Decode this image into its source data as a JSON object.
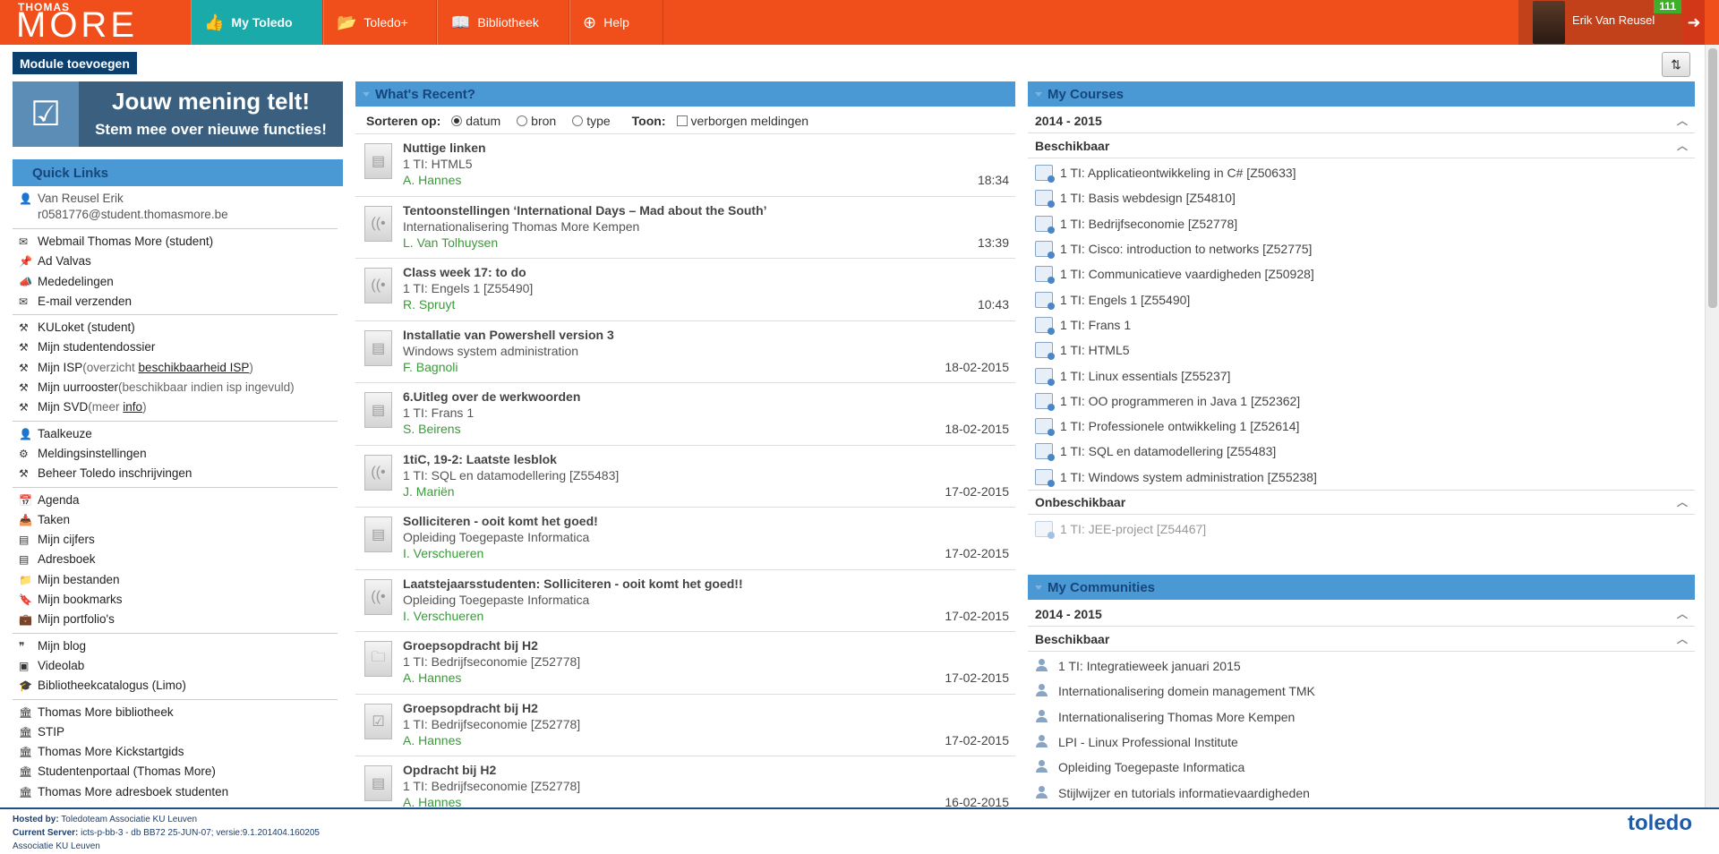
{
  "brand": {
    "small": "THOMAS",
    "big": "MORE"
  },
  "nav": [
    {
      "label": "My Toledo",
      "icon": "👍"
    },
    {
      "label": "Toledo+",
      "icon": "📂"
    },
    {
      "label": "Bibliotheek",
      "icon": "📖"
    },
    {
      "label": "Help",
      "icon": "⊕"
    }
  ],
  "user": {
    "name": "Erik Van Reusel",
    "badge": "111"
  },
  "module_button": "Module toevoegen",
  "promo": {
    "title": "Jouw mening telt!",
    "subtitle": "Stem mee over nieuwe functies!"
  },
  "quicklinks": {
    "title": "Quick Links",
    "user_name": "Van Reusel Erik",
    "user_email": "r0581776@student.thomasmore.be",
    "groups": [
      [
        {
          "icon": "✉",
          "label": "Webmail Thomas More (student)"
        },
        {
          "icon": "📌",
          "label": "Ad Valvas"
        },
        {
          "icon": "📣",
          "label": "Mededelingen"
        },
        {
          "icon": "✉",
          "label": "E-mail verzenden"
        }
      ],
      [
        {
          "icon": "⚒",
          "label": "KULoket (student)"
        },
        {
          "icon": "⚒",
          "label": "Mijn studentendossier"
        },
        {
          "icon": "⚒",
          "label": "Mijn ISP",
          "muted": "(overzicht ",
          "link": "beschikbaarheid ISP",
          "after": ")"
        },
        {
          "icon": "⚒",
          "label": "Mijn uurrooster",
          "muted": "(beschikbaar indien isp ingevuld)"
        },
        {
          "icon": "⚒",
          "label": "Mijn SVD",
          "muted": "(meer ",
          "link": "info",
          "after": ")"
        }
      ],
      [
        {
          "icon": "👤",
          "label": "Taalkeuze"
        },
        {
          "icon": "⚙",
          "label": "Meldingsinstellingen"
        },
        {
          "icon": "⚒",
          "label": "Beheer Toledo inschrijvingen"
        }
      ],
      [
        {
          "icon": "📅",
          "label": "Agenda"
        },
        {
          "icon": "📥",
          "label": "Taken"
        },
        {
          "icon": "▤",
          "label": "Mijn cijfers"
        },
        {
          "icon": "▤",
          "label": "Adresboek"
        },
        {
          "icon": "📁",
          "label": "Mijn bestanden"
        },
        {
          "icon": "🔖",
          "label": "Mijn bookmarks"
        },
        {
          "icon": "💼",
          "label": "Mijn portfolio's"
        }
      ],
      [
        {
          "icon": "❞",
          "label": "Mijn blog"
        },
        {
          "icon": "▣",
          "label": "Videolab"
        },
        {
          "icon": "🎓",
          "label": "Bibliotheekcatalogus (Limo)"
        }
      ],
      [
        {
          "icon": "🏛",
          "label": "Thomas More bibliotheek"
        },
        {
          "icon": "🏛",
          "label": "STIP"
        },
        {
          "icon": "🏛",
          "label": "Thomas More Kickstartgids"
        },
        {
          "icon": "🏛",
          "label": "Studentenportaal (Thomas More)"
        },
        {
          "icon": "🏛",
          "label": "Thomas More adresboek studenten"
        }
      ]
    ]
  },
  "recent": {
    "title": "What's Recent?",
    "sort_label": "Sorteren op:",
    "sort_options": [
      "datum",
      "bron",
      "type"
    ],
    "show_label": "Toon:",
    "show_option": "verborgen meldingen",
    "items": [
      {
        "title": "Nuttige linken",
        "sub": "1 TI: HTML5",
        "author": "A. Hannes",
        "time": "18:34",
        "icon": "doc"
      },
      {
        "title": "Tentoonstellingen ‘International Days – Mad about the South’",
        "sub": "Internationalisering Thomas More Kempen",
        "author": "L. Van Tolhuysen",
        "time": "13:39",
        "icon": "ann"
      },
      {
        "title": "Class week 17: to do",
        "sub": "1 TI: Engels 1 [Z55490]",
        "author": "R. Spruyt",
        "time": "10:43",
        "icon": "ann"
      },
      {
        "title": "Installatie van Powershell version 3",
        "sub": "Windows system administration",
        "author": "F. Bagnoli",
        "time": "18-02-2015",
        "icon": "doc"
      },
      {
        "title": "6.Uitleg over de werkwoorden",
        "sub": "1 TI: Frans 1",
        "author": "S. Beirens",
        "time": "18-02-2015",
        "icon": "doc"
      },
      {
        "title": "1tiC, 19-2: Laatste lesblok",
        "sub": "1 TI: SQL en datamodellering [Z55483]",
        "author": "J. Mariën",
        "time": "17-02-2015",
        "icon": "ann"
      },
      {
        "title": "Solliciteren - ooit komt het goed!",
        "sub": "Opleiding Toegepaste Informatica",
        "author": "I. Verschueren",
        "time": "17-02-2015",
        "icon": "doc"
      },
      {
        "title": "Laatstejaarsstudenten: Solliciteren - ooit komt het goed!!",
        "sub": "Opleiding Toegepaste Informatica",
        "author": "I. Verschueren",
        "time": "17-02-2015",
        "icon": "ann"
      },
      {
        "title": "Groepsopdracht bij H2",
        "sub": "1 TI: Bedrijfseconomie [Z52778]",
        "author": "A. Hannes",
        "time": "17-02-2015",
        "icon": "folder"
      },
      {
        "title": "Groepsopdracht bij H2",
        "sub": "1 TI: Bedrijfseconomie [Z52778]",
        "author": "A. Hannes",
        "time": "17-02-2015",
        "icon": "task"
      },
      {
        "title": "Opdracht bij H2",
        "sub": "1 TI: Bedrijfseconomie [Z52778]",
        "author": "A. Hannes",
        "time": "16-02-2015",
        "icon": "doc"
      }
    ]
  },
  "courses": {
    "title": "My Courses",
    "year": "2014 - 2015",
    "available_label": "Beschikbaar",
    "available": [
      "1 TI: Applicatieontwikkeling in C# [Z50633]",
      "1 TI: Basis webdesign [Z54810]",
      "1 TI: Bedrijfseconomie [Z52778]",
      "1 TI: Cisco: introduction to networks [Z52775]",
      "1 TI: Communicatieve vaardigheden [Z50928]",
      "1 TI: Engels 1 [Z55490]",
      "1 TI: Frans 1",
      "1 TI: HTML5",
      "1 TI: Linux essentials [Z55237]",
      "1 TI: OO programmeren in Java 1 [Z52362]",
      "1 TI: Professionele ontwikkeling 1 [Z52614]",
      "1 TI: SQL en datamodellering [Z55483]",
      "1 TI: Windows system administration [Z55238]"
    ],
    "unavailable_label": "Onbeschikbaar",
    "unavailable": [
      "1 TI: JEE-project [Z54467]"
    ]
  },
  "communities": {
    "title": "My Communities",
    "year": "2014 - 2015",
    "available_label": "Beschikbaar",
    "items": [
      "1 TI: Integratieweek januari 2015",
      "Internationalisering domein management TMK",
      "Internationalisering Thomas More Kempen",
      "LPI - Linux Professional Institute",
      "Opleiding Toegepaste Informatica",
      "Stijlwijzer en tutorials informatievaardigheden"
    ]
  },
  "footer": {
    "hosted_label": "Hosted by:",
    "hosted_value": "Toledoteam Associatie KU Leuven",
    "server_label": "Current Server:",
    "server_value": "icts-p-bb-3 - db BB72 25-JUN-07; versie:9.1.201404.160205",
    "assoc": "Associatie KU Leuven",
    "logo": "toledo"
  }
}
